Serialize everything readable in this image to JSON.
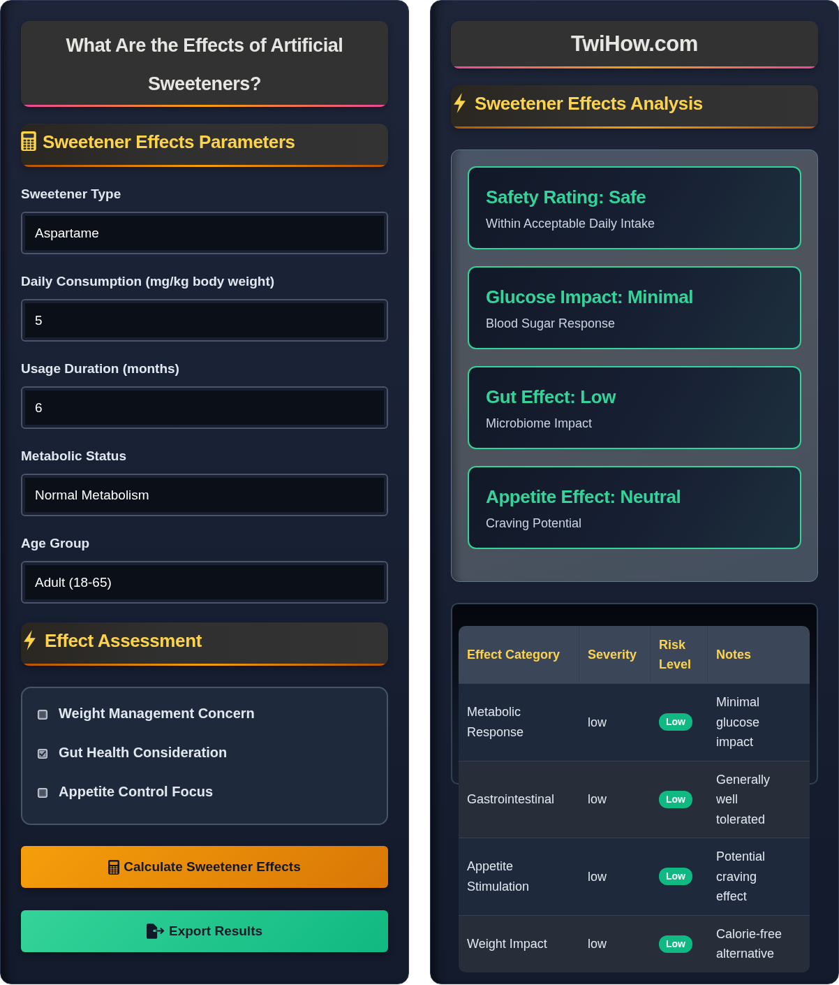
{
  "left_panel": {
    "title": "What Are the Effects of Artificial Sweeteners?",
    "parameters_heading": "Sweetener Effects Parameters",
    "fields": [
      {
        "label": "Sweetener Type",
        "value": "Aspartame"
      },
      {
        "label": "Daily Consumption (mg/kg body weight)",
        "value": "5"
      },
      {
        "label": "Usage Duration (months)",
        "value": "6"
      },
      {
        "label": "Metabolic Status",
        "value": "Normal Metabolism"
      },
      {
        "label": "Age Group",
        "value": "Adult (18-65)"
      }
    ],
    "assessment_heading": "Effect Assessment",
    "checkboxes": [
      {
        "label": "Weight Management Concern",
        "checked": false
      },
      {
        "label": "Gut Health Consideration",
        "checked": true
      },
      {
        "label": "Appetite Control Focus",
        "checked": false
      }
    ],
    "buttons": [
      {
        "label": "Calculate Sweetener Effects",
        "kind": "calculate"
      },
      {
        "label": "Export Results",
        "kind": "export"
      }
    ]
  },
  "right_panel": {
    "site_title": "TwiHow.com",
    "analysis_heading": "Sweetener Effects Analysis",
    "result_cards": [
      {
        "title": "Safety Rating: Safe",
        "subtitle": "Within Acceptable Daily Intake"
      },
      {
        "title": "Glucose Impact: Minimal",
        "subtitle": "Blood Sugar Response"
      },
      {
        "title": "Gut Effect: Low",
        "subtitle": "Microbiome Impact"
      },
      {
        "title": "Appetite Effect: Neutral",
        "subtitle": "Craving Potential"
      }
    ],
    "table": {
      "columns": [
        "Effect Category",
        "Severity",
        "Risk Level",
        "Notes"
      ],
      "rows": [
        {
          "category": "Metabolic Response",
          "severity": "low",
          "risk": "Low",
          "notes": "Minimal glucose impact"
        },
        {
          "category": "Gastrointestinal",
          "severity": "low",
          "risk": "Low",
          "notes": "Generally well tolerated"
        },
        {
          "category": "Appetite Stimulation",
          "severity": "low",
          "risk": "Low",
          "notes": "Potential craving effect"
        },
        {
          "category": "Weight Impact",
          "severity": "low",
          "risk": "Low",
          "notes": "Calorie-free alternative"
        }
      ]
    }
  }
}
